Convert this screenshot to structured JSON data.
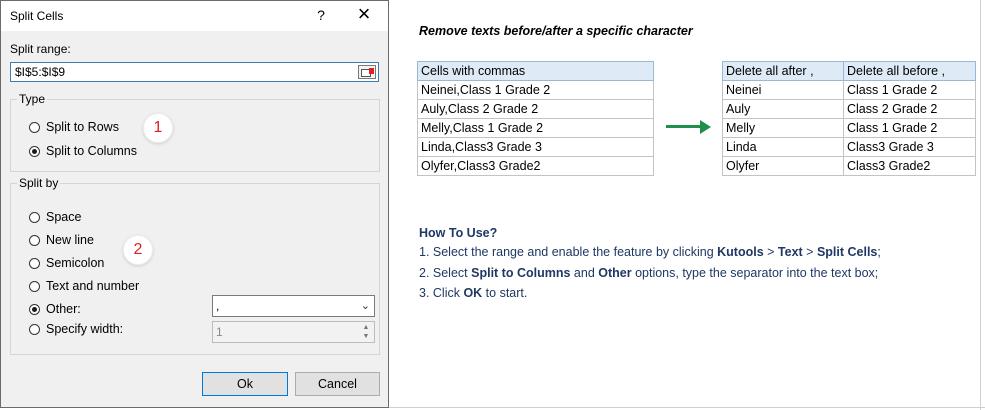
{
  "dialog": {
    "title": "Split Cells",
    "help": "?",
    "close": "×",
    "split_range_label": "Split range:",
    "split_range_value": "$I$5:$I$9",
    "type_group": "Type",
    "type_options": [
      "Split to Rows",
      "Split to Columns"
    ],
    "type_selected": "Split to Columns",
    "split_by_group": "Split by",
    "split_by_options": [
      "Space",
      "New line",
      "Semicolon",
      "Text and number",
      "Other:",
      "Specify width:"
    ],
    "split_by_selected": "Other:",
    "other_value": ",",
    "width_value": "1",
    "ok": "Ok",
    "cancel": "Cancel",
    "badges": [
      "1",
      "2"
    ]
  },
  "panel": {
    "heading": "Remove texts before/after a specific character",
    "source_table": {
      "header": "Cells with commas",
      "rows": [
        "Neinei,Class 1 Grade 2",
        "Auly,Class 2 Grade 2",
        "Melly,Class 1 Grade 2",
        "Linda,Class3 Grade 3",
        "Olyfer,Class3 Grade2"
      ]
    },
    "result_table": {
      "headers": [
        "Delete all after ,",
        "Delete all before ,"
      ],
      "rows": [
        [
          "Neinei",
          "Class 1 Grade 2"
        ],
        [
          "Auly",
          "Class 2 Grade 2"
        ],
        [
          "Melly",
          "Class 1 Grade 2"
        ],
        [
          "Linda",
          "Class3 Grade 3"
        ],
        [
          "Olyfer",
          "Class3 Grade2"
        ]
      ]
    },
    "how_to_title": "How To Use?",
    "steps": {
      "s1_a": "1. Select the range and enable the feature by clicking ",
      "s1_b": "Kutools",
      "s1_c": " > ",
      "s1_d": "Text",
      "s1_e": " > ",
      "s1_f": "Split Cells",
      "s1_g": ";",
      "s2_a": "2. Select ",
      "s2_b": "Split to Columns",
      "s2_c": " and ",
      "s2_d": "Other",
      "s2_e": " options, type the separator into the text box;",
      "s3_a": "3. Click ",
      "s3_b": "OK",
      "s3_c": " to start."
    }
  },
  "colors": {
    "arrow": "#1f8f4e",
    "badge_text": "#e02020",
    "header_fill": "#deebf7",
    "steps_text": "#1f3864"
  }
}
